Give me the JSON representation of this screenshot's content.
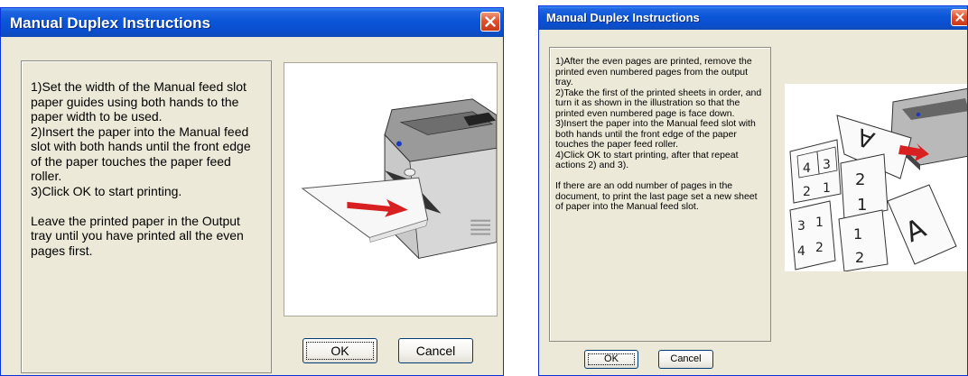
{
  "dialog_left": {
    "title": "Manual Duplex Instructions",
    "instructions": "1)Set the width of the Manual feed slot paper guides using both hands to the paper width to be used.\n2)Insert the paper into the Manual feed slot with both hands until the front edge of the paper touches the paper feed roller.\n3)Click OK to start printing.\n\nLeave the printed paper in the Output tray until you have printed all the even pages first.",
    "ok_label": "OK",
    "cancel_label": "Cancel",
    "illustration": "printer-manual-feed-illustration"
  },
  "dialog_right": {
    "title": "Manual Duplex Instructions",
    "instructions": "1)After the even pages are printed, remove the printed even numbered pages from the output tray.\n2)Take the first of the printed sheets in order, and turn it as shown in the illustration so that the printed even numbered page is face down.\n3)Insert the paper into the Manual feed slot with both hands until the front edge of the paper touches the paper feed roller.\n4)Click OK to start printing, after that repeat actions 2) and 3).\n\n If there are an odd number of pages in the document, to print the last page set a new sheet of paper into the Manual feed slot.",
    "ok_label": "OK",
    "cancel_label": "Cancel",
    "illustration": "duplex-page-order-illustration"
  },
  "colors": {
    "dialog_bg": "#ece9d8",
    "titlebar_blue": "#0a56d8",
    "close_red": "#e0522f"
  }
}
